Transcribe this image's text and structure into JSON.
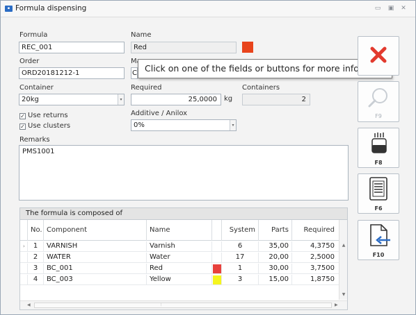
{
  "window": {
    "title": "Formula dispensing",
    "icon": "app-icon"
  },
  "form": {
    "formula_label": "Formula",
    "formula_value": "REC_001",
    "name_label": "Name",
    "name_value": "Red",
    "name_color": "#e8441c",
    "order_label": "Order",
    "order_value": "ORD20181212-1",
    "ma_label_fragment": "Ma",
    "ma_value_fragment": "C(",
    "container_label": "Container",
    "container_value": "20kg",
    "required_label": "Required",
    "required_value": "25,0000",
    "required_unit": "kg",
    "containers_label": "Containers",
    "containers_value": "2",
    "use_returns_label": "Use returns",
    "use_returns_checked": true,
    "use_clusters_label": "Use clusters",
    "use_clusters_checked": true,
    "additive_label": "Additive / Anilox",
    "additive_value": "0%",
    "remarks_label": "Remarks",
    "remarks_value": "PMS1001"
  },
  "tooltip": "Click on one of the fields or buttons for more information.",
  "grid": {
    "caption": "The formula is composed of",
    "columns": [
      "No.",
      "Component",
      "Name",
      "System",
      "Parts",
      "Required"
    ],
    "rows": [
      {
        "no": "1",
        "component": "VARNISH",
        "name": "Varnish",
        "color": "",
        "system": "6",
        "parts": "35,00",
        "required": "4,3750",
        "current": true
      },
      {
        "no": "2",
        "component": "WATER",
        "name": "Water",
        "color": "",
        "system": "17",
        "parts": "20,00",
        "required": "2,5000",
        "current": false
      },
      {
        "no": "3",
        "component": "BC_001",
        "name": "Red",
        "color": "#e8413c",
        "system": "1",
        "parts": "30,00",
        "required": "3,7500",
        "current": false
      },
      {
        "no": "4",
        "component": "BC_003",
        "name": "Yellow",
        "color": "#f5f51e",
        "system": "3",
        "parts": "15,00",
        "required": "1,8750",
        "current": false
      }
    ]
  },
  "toolbar": [
    {
      "key": "",
      "icon": "cancel-x-icon",
      "enabled": true
    },
    {
      "key": "F9",
      "icon": "magnifier-icon",
      "enabled": false
    },
    {
      "key": "F8",
      "icon": "container-dispense-icon",
      "enabled": true
    },
    {
      "key": "F6",
      "icon": "document-list-icon",
      "enabled": true
    },
    {
      "key": "F10",
      "icon": "document-import-icon",
      "enabled": true
    }
  ],
  "colors": {
    "accent_red": "#e23a2e",
    "window_border": "#9aa7b6"
  }
}
